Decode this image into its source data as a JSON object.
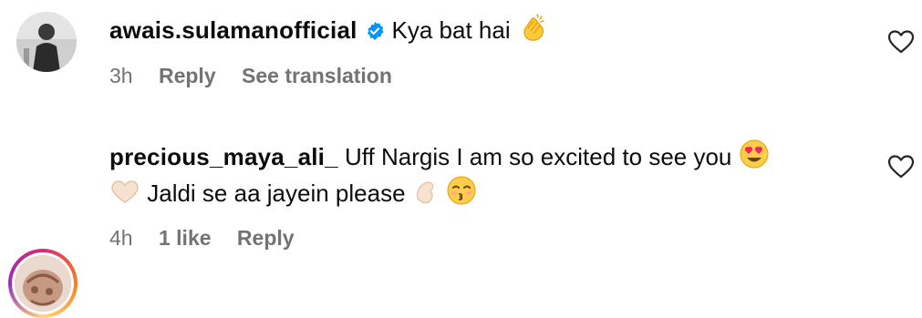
{
  "comments": [
    {
      "username": "awais.sulamanofficial",
      "text1": "Kya bat hai",
      "time": "3h",
      "reply": "Reply",
      "translate": "See translation"
    },
    {
      "username": "precious_maya_ali_",
      "text1": "Uff Nargis I am so excited to see you",
      "text2": "Jaldi se aa jayein please",
      "time": "4h",
      "likes": "1 like",
      "reply": "Reply"
    }
  ],
  "icons": {
    "verified": "verified-badge-icon",
    "heart": "heart-outline-icon",
    "clap": "clapping-hands-emoji",
    "heart_eyes": "heart-eyes-emoji",
    "heart_hands": "heart-hands-emoji",
    "pinch": "pinching-hand-emoji",
    "kiss": "kissing-face-emoji"
  },
  "colors": {
    "verified": "#0095f6",
    "meta": "#737373"
  }
}
